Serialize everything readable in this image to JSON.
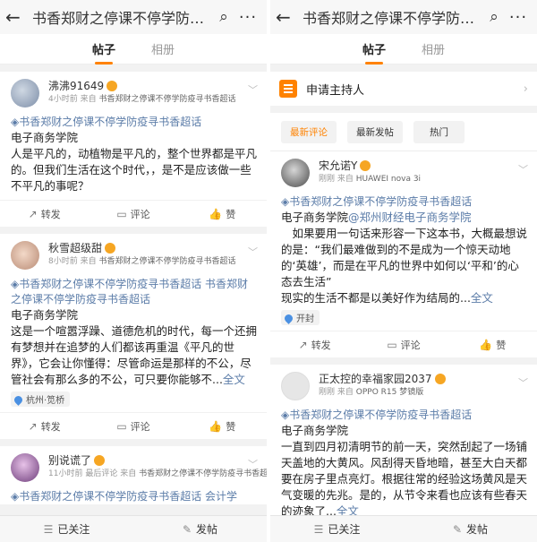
{
  "left": {
    "header": {
      "back_icon": "arrow-left-icon",
      "title": "书香郑财之停课不停学防疫寻书香超话",
      "search_icon": "search-icon",
      "more_label": "···"
    },
    "tabs": [
      {
        "label": "帖子",
        "active": true
      },
      {
        "label": "相册",
        "active": false
      }
    ],
    "posts": [
      {
        "username": "沸沸91649",
        "time": "4小时前",
        "from_label": "来自",
        "source": "书香郑财之停课不停学防疫寻书香超话",
        "topic": "书香郑财之停课不停学防疫寻书香超话",
        "body": "电子商务学院\n人是平凡的，动植物是平凡的，整个世界都是平凡的。但我们生活在这个时代，，是不是应该做一些不平凡的事呢？",
        "repost": "转发",
        "comment": "评论",
        "like": "赞"
      },
      {
        "username": "秋雪超级甜",
        "time": "8小时前",
        "from_label": "来自",
        "source": "书香郑财之停课不停学防疫寻书香超话",
        "topic": "书香郑财之停课不停学防疫寻书香超话 书香郑财之停课不停学防疫寻书香超话",
        "body": "电子商务学院\n这是一个喧嚣浮躁、道德危机的时代，每一个还拥有梦想并在追梦的人们都该再重温《平凡的世界》，它会让你懂得：尽管命运是那样的不公，尽管社会有那么多的不公，可只要你能够不...",
        "full": "全文",
        "location": "杭州·笕桥",
        "repost": "转发",
        "comment": "评论",
        "like": "赞"
      },
      {
        "username": "别说谎了",
        "time": "11小时前",
        "reply_label": "最后评论",
        "from_label": "来自",
        "source": "书香郑财之停课不停学防疫寻书香超话",
        "topic": "书香郑财之停课不停学防疫寻书香超话 会计学"
      }
    ],
    "bottom": {
      "follow": "已关注",
      "post": "发帖"
    }
  },
  "right": {
    "header": {
      "back_icon": "arrow-left-icon",
      "title": "书香郑财之停课不停学防疫寻书香超话",
      "search_icon": "search-icon",
      "more_label": "···"
    },
    "tabs": [
      {
        "label": "帖子",
        "active": true
      },
      {
        "label": "相册",
        "active": false
      }
    ],
    "host_label": "申请主持人",
    "sort": [
      "最新评论",
      "最新发帖",
      "热门"
    ],
    "posts": [
      {
        "username": "宋允诺Y",
        "time": "刚刚",
        "from_label": "来自",
        "source": "HUAWEI nova 3i",
        "topic": "书香郑财之停课不停学防疫寻书香超话",
        "body_prefix": "电子商务学院",
        "mention": "@郑州财经电子商务学院",
        "body": "如果要用一句话来形容一下这本书，大概最想说的是：“我们最难做到的不是成为一个惊天动地的‘英雄’，而是在平凡的世界中如何以‘平和’的心态去生活”\n现实的生活不都是以美好作为结局的...",
        "full": "全文",
        "location": "开封",
        "repost": "转发",
        "comment": "评论",
        "like": "赞"
      },
      {
        "username": "正太控的幸福家园2037",
        "time": "刚刚",
        "from_label": "来自",
        "source": "OPPO R15 梦镜版",
        "topic": "书香郑财之停课不停学防疫寻书香超话",
        "body": "电子商务学院\n一直到四月初清明节的前一天，突然刮起了一场铺天盖地的大黄风。风刮得天昏地暗，甚至大白天都要在房子里点亮灯。根据往常的经验这场黄风是天气变暖的先兆。是的，从节令来看也应该有些春天的迹象了...",
        "full": "全文"
      }
    ],
    "bottom": {
      "follow": "已关注",
      "post": "发帖"
    }
  }
}
